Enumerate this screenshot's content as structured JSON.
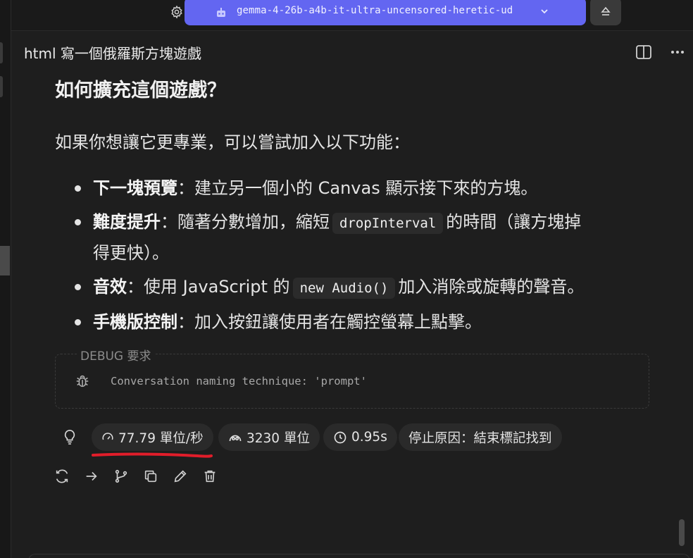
{
  "model": {
    "name": "gemma-4-26b-a4b-it-ultra-uncensored-heretic-ud"
  },
  "conversation": {
    "title": "html 寫一個俄羅斯方塊遊戲"
  },
  "message": {
    "heading": "如何擴充這個遊戲？",
    "intro": "如果你想讓它更專業，可以嘗試加入以下功能：",
    "bullets": [
      {
        "bold": "下一塊預覽",
        "text_a": "：建立另一個小的 Canvas 顯示接下來的方塊。",
        "code": "",
        "text_b": ""
      },
      {
        "bold": "難度提升",
        "text_a": "：隨著分數增加，縮短",
        "code": "dropInterval",
        "text_b": "的時間（讓方塊掉",
        "text_c": "得更快）。"
      },
      {
        "bold": "音效",
        "text_a": "：使用 JavaScript 的",
        "code": "new Audio()",
        "text_b": "加入消除或旋轉的聲音。"
      },
      {
        "bold": "手機版控制",
        "text_a": "：加入按鈕讓使用者在觸控螢幕上點擊。",
        "code": "",
        "text_b": ""
      }
    ]
  },
  "debug": {
    "legend": "DEBUG 要求",
    "text": "Conversation naming technique: 'prompt'"
  },
  "stats": {
    "speed": "77.79 單位/秒",
    "tokens": "3230 單位",
    "time": "0.95s",
    "stop_reason": "停止原因：結束標記找到"
  },
  "icons": [
    "gear-icon",
    "robot-icon",
    "chevron-down-icon",
    "eject-icon",
    "split-view-icon",
    "more-icon",
    "bug-icon",
    "lightbulb-icon",
    "speedometer-icon",
    "tokens-icon",
    "clock-icon",
    "regenerate-icon",
    "continue-icon",
    "branch-icon",
    "copy-icon",
    "edit-icon",
    "delete-icon"
  ],
  "colors": {
    "accent": "#6366f1",
    "highlight_underline": "#e11d2a",
    "background": "#1e1e1e",
    "chip": "#2a2a2a"
  }
}
